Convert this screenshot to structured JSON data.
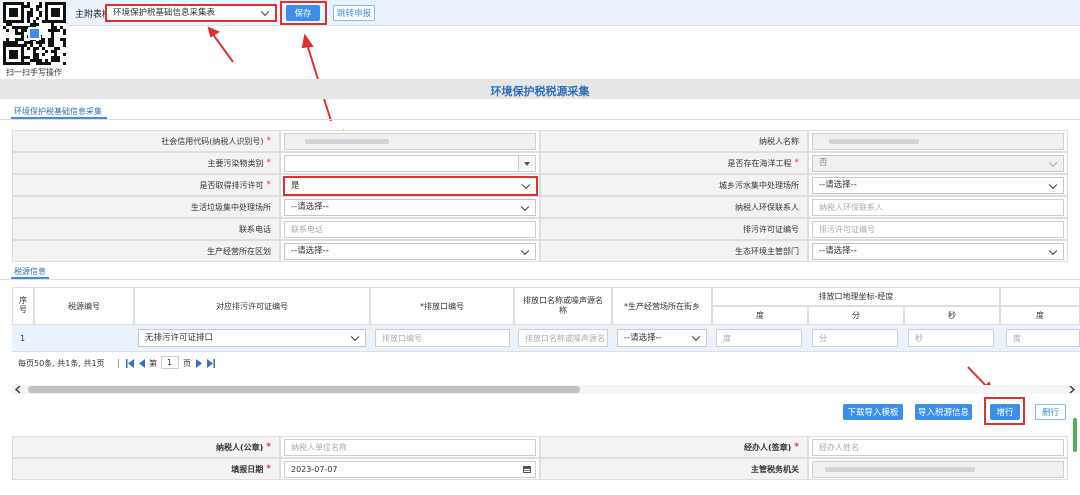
{
  "header": {
    "main_table_label": "主附表树:",
    "main_table_value": "环境保护税基础信息采集表",
    "save_label": "保存",
    "jump_label": "跳转申报",
    "scan_text": "扫一扫手写操作"
  },
  "page_title": "环境保护税税源采集",
  "tab_basic": "环境保护税基础信息采集",
  "basic_form": {
    "credit_code_label": "社会信用代码(纳税人识别号)",
    "taxpayer_name_label": "纳税人名称",
    "pollutant_type_label": "主要污染物类别",
    "marine_project_label": "是否存在海洋工程",
    "marine_project_value": "否",
    "permit_label": "是否取得排污许可",
    "permit_value": "是",
    "sewage_center_label": "城乡污水集中处理场所",
    "sewage_center_value": "--请选择--",
    "garbage_center_label": "生活垃圾集中处理场所",
    "garbage_center_value": "--请选择--",
    "env_contact_label": "纳税人环保联系人",
    "env_contact_placeholder": "纳税人环保联系人",
    "phone_label": "联系电话",
    "phone_placeholder": "联系电话",
    "permit_no_label": "排污许可证编号",
    "permit_no_placeholder": "排污许可证编号",
    "district_label": "生产经营所在区划",
    "district_value": "--请选择--",
    "eco_dept_label": "生态环境主管部门",
    "eco_dept_value": "--请选择--"
  },
  "tab_source": "税源信息",
  "source_table": {
    "headers": {
      "seq": "序号",
      "source_no": "税源编号",
      "permit_no": "对应排污许可证编号",
      "outlet_no": "*排放口编号",
      "outlet_name": "排放口名称或噪声源名称",
      "street": "*生产经营场所在街乡",
      "geo": "排放口地理坐标-经度",
      "deg": "度",
      "min": "分",
      "sec": "秒",
      "deg2": "度"
    },
    "row": {
      "seq": "1",
      "permit_value": "无排污许可证排口",
      "outlet_placeholder": "排放口编号",
      "name_placeholder": "排放口名称或噪声源名",
      "street_value": "--请选择--",
      "deg_placeholder": "度",
      "min_placeholder": "分",
      "sec_placeholder": "秒",
      "deg2_placeholder": "度"
    },
    "pager_text": "每页50条, 共1条, 共1页",
    "page_prefix": "第",
    "page_value": "1",
    "page_suffix": "页"
  },
  "actions": {
    "download_template": "下载导入模板",
    "import_source": "导入税源信息",
    "add_row": "增行",
    "delete_row": "删行"
  },
  "footer_form": {
    "taxpayer_seal_label": "纳税人(公章)",
    "taxpayer_seal_placeholder": "纳税人单位名称",
    "agent_label": "经办人(签章)",
    "agent_placeholder": "经办人姓名",
    "fill_date_label": "填报日期",
    "fill_date_value": "2023-07-07",
    "tax_authority_label": "主管税务机关"
  },
  "colors": {
    "accent": "#3b8fe8",
    "annotation": "#e03131",
    "title": "#2f6fb8"
  }
}
